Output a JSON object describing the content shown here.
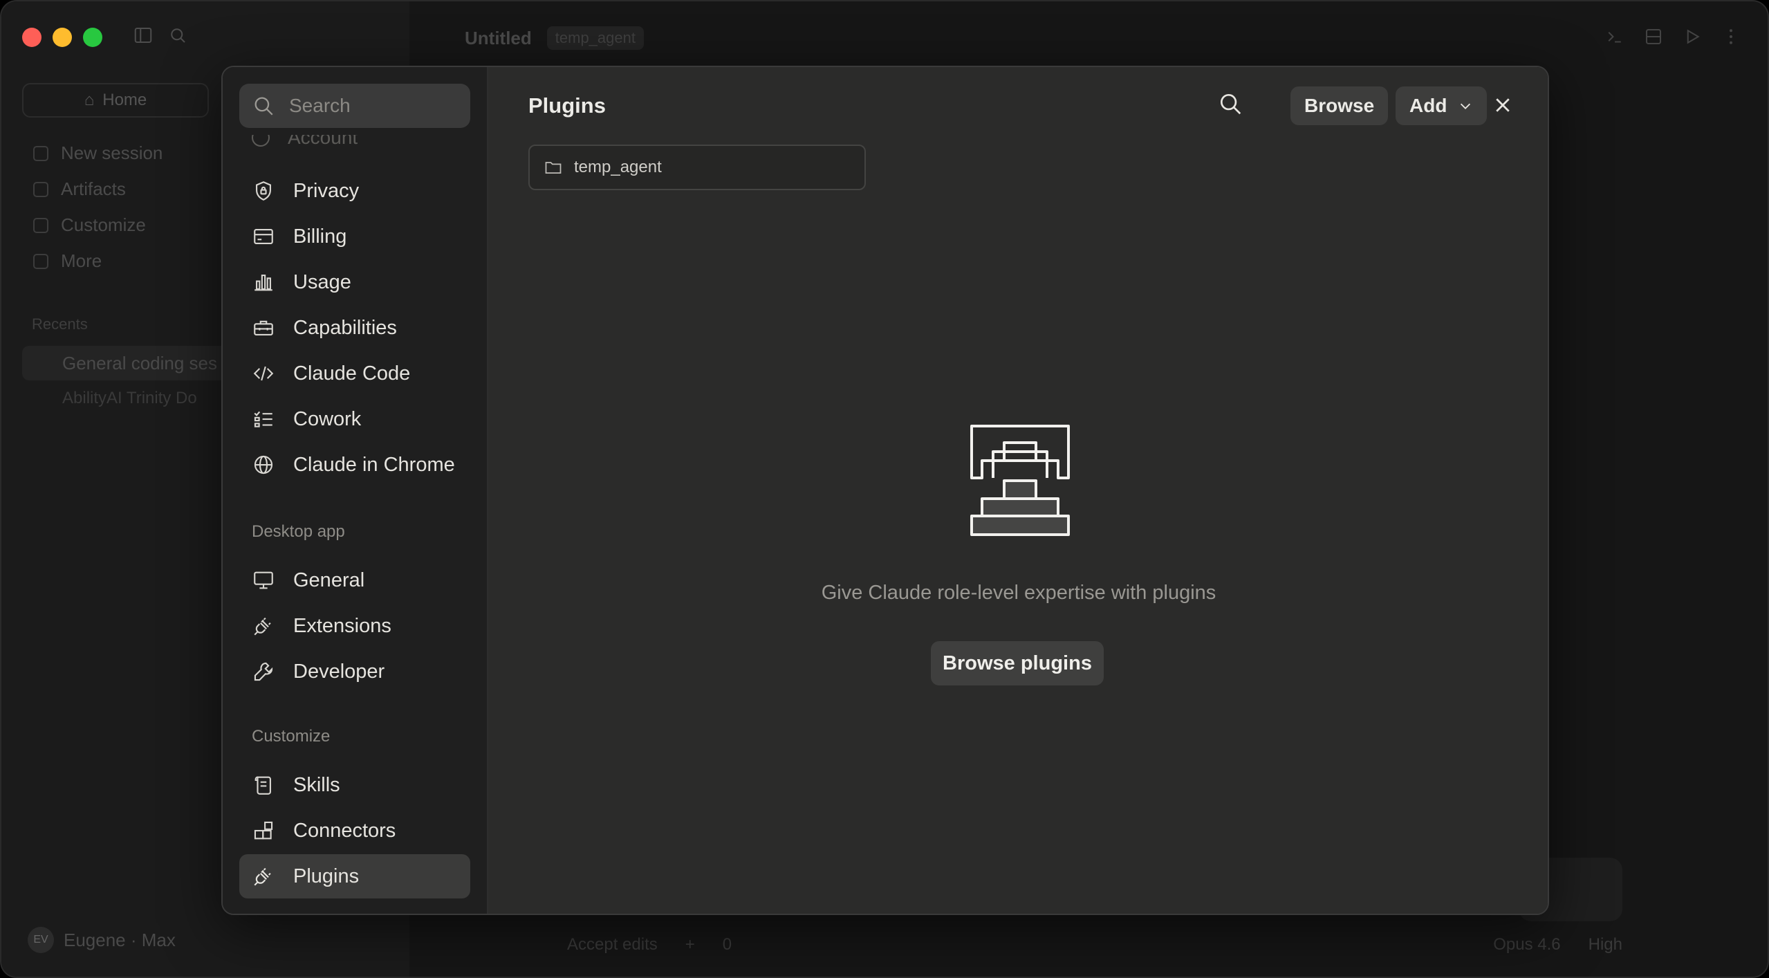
{
  "window": {
    "title": "Untitled",
    "project_chip": "temp_agent"
  },
  "background_app": {
    "home_label": "Home",
    "nav": [
      "New session",
      "Artifacts",
      "Customize",
      "More"
    ],
    "recents_label": "Recents",
    "recents": [
      "General coding ses",
      "AbilityAI Trinity Do"
    ],
    "user_initials": "EV",
    "user_name": "Eugene · Max",
    "bottom_left": [
      "Accept edits",
      "+",
      "0"
    ],
    "bottom_right": [
      "Opus 4.6",
      "High"
    ]
  },
  "settings": {
    "search_placeholder": "Search",
    "cutoff_item": "Account",
    "account_items": [
      {
        "label": "Privacy",
        "icon": "shield-lock-icon"
      },
      {
        "label": "Billing",
        "icon": "credit-card-icon"
      },
      {
        "label": "Usage",
        "icon": "bar-chart-icon"
      },
      {
        "label": "Capabilities",
        "icon": "toolbox-icon"
      },
      {
        "label": "Claude Code",
        "icon": "code-icon"
      },
      {
        "label": "Cowork",
        "icon": "checklist-icon"
      },
      {
        "label": "Claude in Chrome",
        "icon": "globe-icon"
      }
    ],
    "desktop_section": "Desktop app",
    "desktop_items": [
      {
        "label": "General",
        "icon": "monitor-icon"
      },
      {
        "label": "Extensions",
        "icon": "plug-icon"
      },
      {
        "label": "Developer",
        "icon": "wrench-icon"
      }
    ],
    "customize_section": "Customize",
    "customize_items": [
      {
        "label": "Skills",
        "icon": "scroll-icon"
      },
      {
        "label": "Connectors",
        "icon": "blocks-icon"
      },
      {
        "label": "Plugins",
        "icon": "plug-icon",
        "active": true
      }
    ]
  },
  "plugins_page": {
    "title": "Plugins",
    "browse_button": "Browse",
    "add_button": "Add",
    "folder_chip": "temp_agent",
    "empty_message": "Give Claude role-level expertise with plugins",
    "browse_plugins_button": "Browse plugins"
  }
}
